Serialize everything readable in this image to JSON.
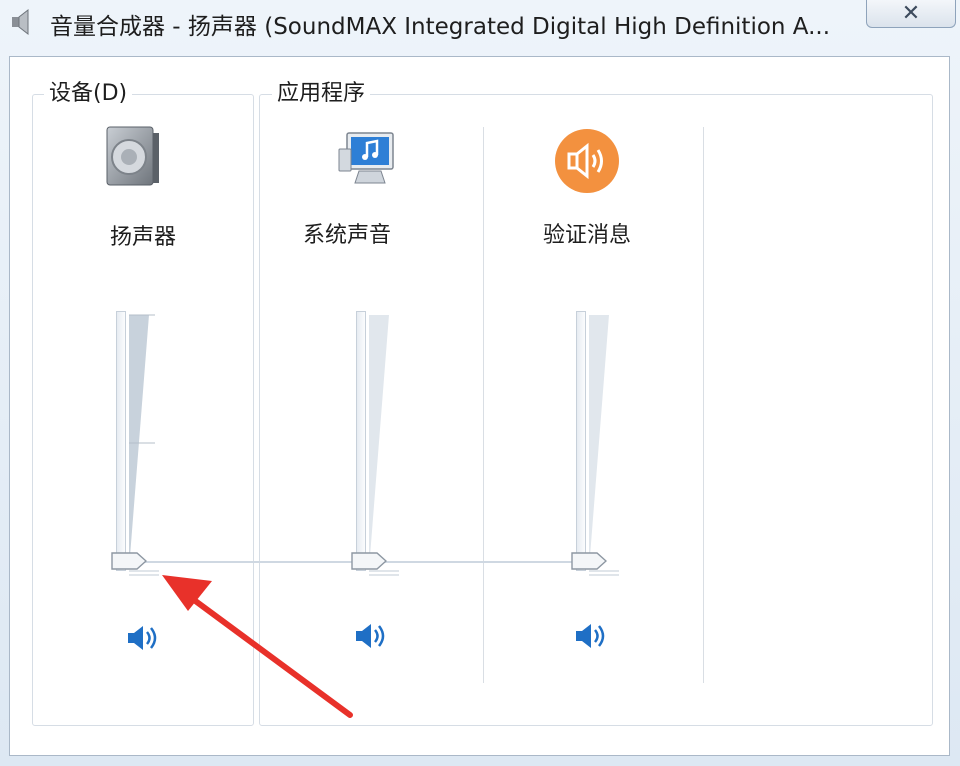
{
  "window": {
    "title": "音量合成器 - 扬声器 (SoundMAX Integrated Digital High Definition A...",
    "close_label": "✕"
  },
  "devices": {
    "legend": "设备(D)",
    "channels": [
      {
        "label": "扬声器",
        "icon": "speaker-device-icon",
        "volume": 0,
        "mute_icon": "speaker-volume-icon"
      }
    ]
  },
  "applications": {
    "legend": "应用程序",
    "channels": [
      {
        "label": "系统声音",
        "icon": "system-sounds-icon",
        "volume": 0,
        "mute_icon": "speaker-volume-icon"
      },
      {
        "label": "验证消息",
        "icon": "notification-sound-icon",
        "volume": 0,
        "mute_icon": "speaker-volume-icon"
      }
    ]
  },
  "colors": {
    "accent_blue": "#1f6fc5",
    "notification_orange": "#f3913f",
    "annotation_arrow": "#e8312a"
  }
}
